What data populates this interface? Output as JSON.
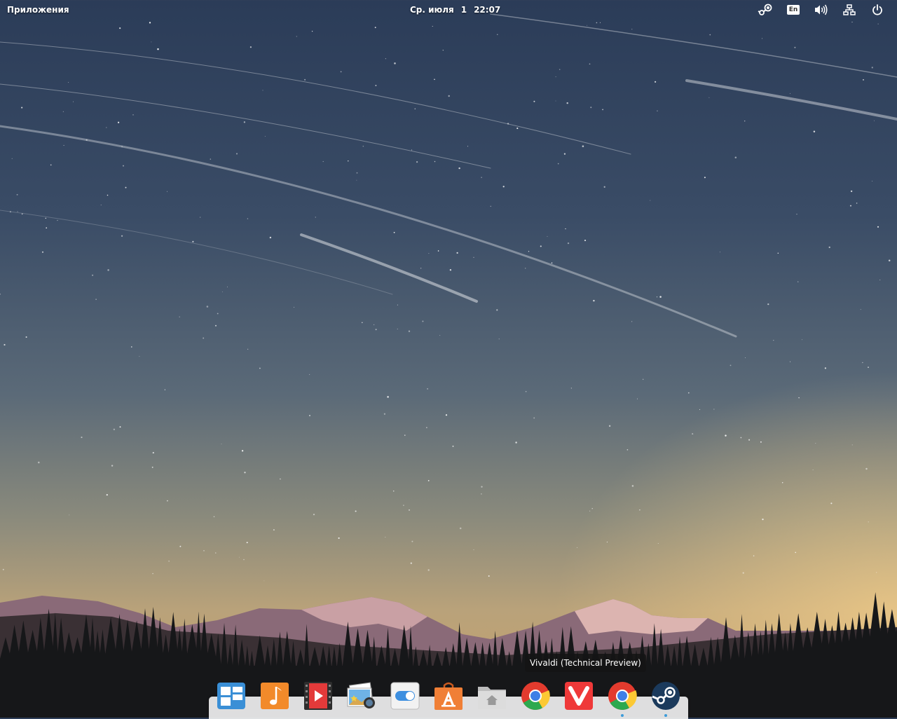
{
  "panel": {
    "apps_label": "Приложения",
    "clock_day": "Ср. июля",
    "clock_date": "1",
    "clock_time": "22:07",
    "indicators": {
      "steam": "steam-icon",
      "keyboard": "En",
      "sound": "volume-icon",
      "network": "network-icon",
      "power": "power-icon"
    }
  },
  "tooltip": {
    "text": "Vivaldi (Technical Preview)"
  },
  "dock": {
    "items": [
      {
        "name": "multitasking-view",
        "running": false
      },
      {
        "name": "music",
        "running": false
      },
      {
        "name": "videos",
        "running": false
      },
      {
        "name": "photos",
        "running": false
      },
      {
        "name": "system-settings",
        "running": false
      },
      {
        "name": "app-center",
        "running": false
      },
      {
        "name": "files",
        "running": false
      },
      {
        "name": "chrome",
        "running": false
      },
      {
        "name": "vivaldi",
        "running": false
      },
      {
        "name": "chrome",
        "running": true
      },
      {
        "name": "steam",
        "running": true
      }
    ]
  },
  "colors": {
    "running_indicator": "#3d9bd9",
    "vivaldi_red": "#ef3939",
    "music_orange": "#f28a2a",
    "appcenter_orange": "#f07f36"
  }
}
